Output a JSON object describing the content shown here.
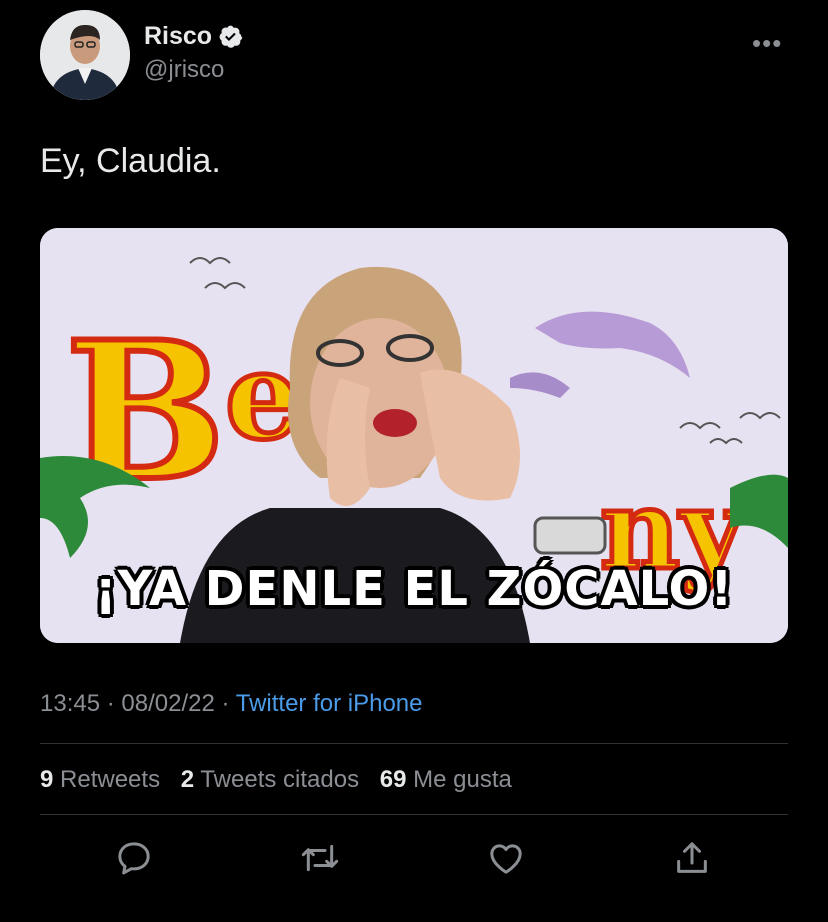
{
  "author": {
    "name": "Risco",
    "handle": "@jrisco",
    "verified": true,
    "avatar_icon": "profile-photo"
  },
  "menu": {
    "icon": "more-options-icon",
    "glyph": "•••"
  },
  "tweet": {
    "text": "Ey, Claudia.",
    "media": {
      "caption": "¡YA DENLE EL ZÓCALO!"
    },
    "time": "13:45",
    "date": "08/02/22",
    "separator": "·",
    "source": "Twitter for iPhone"
  },
  "stats": {
    "retweets": {
      "count": "9",
      "label": "Retweets"
    },
    "quotes": {
      "count": "2",
      "label": "Tweets citados"
    },
    "likes": {
      "count": "69",
      "label": "Me gusta"
    }
  },
  "actions": [
    {
      "name": "reply",
      "icon": "reply-icon"
    },
    {
      "name": "retweet",
      "icon": "retweet-icon"
    },
    {
      "name": "like",
      "icon": "like-icon"
    },
    {
      "name": "share",
      "icon": "share-icon"
    }
  ],
  "colors": {
    "background": "#000000",
    "text": "#e7e9ea",
    "secondary": "#8b8f94",
    "link": "#4a9be8",
    "divider": "#2f3336"
  }
}
